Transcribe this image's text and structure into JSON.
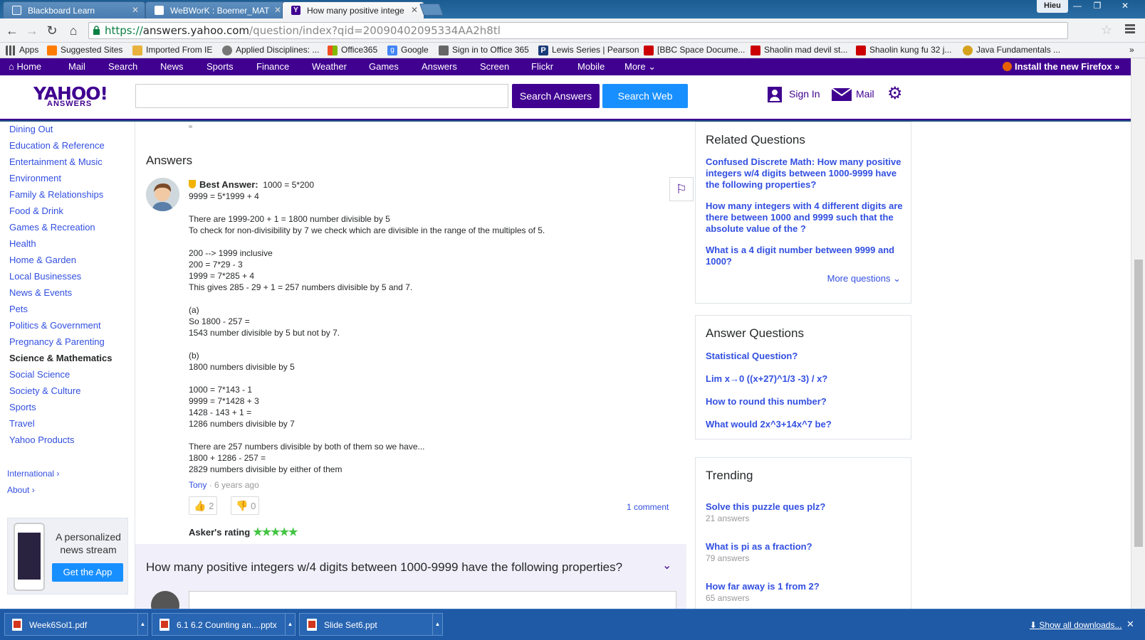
{
  "browser": {
    "tabs": [
      {
        "title": "Blackboard Learn",
        "icon_color": "#4a7db0"
      },
      {
        "title": "WeBWorK : Boerner_MAT",
        "icon_color": "#ffffff"
      },
      {
        "title": "How many positive intege",
        "icon_color": "#400090"
      }
    ],
    "user": "Hieu",
    "url": {
      "scheme": "https://",
      "host": "answers.yahoo.com",
      "path": "/question/index?qid=20090402095334AA2h8tl"
    },
    "bookmarks": [
      {
        "label": "Apps",
        "color": "#555555"
      },
      {
        "label": "Suggested Sites",
        "color": "#ff7c00"
      },
      {
        "label": "Imported From IE",
        "color": "#e8b23c"
      },
      {
        "label": "Applied Disciplines: ...",
        "color": "#777777"
      },
      {
        "label": "Office365",
        "color": "#e34b1c"
      },
      {
        "label": "Google",
        "color": "#4285f4"
      },
      {
        "label": "Sign in to Office 365",
        "color": "#666666"
      },
      {
        "label": "Lewis Series | Pearson",
        "color": "#1a3c78"
      },
      {
        "label": "[BBC Space Docume...",
        "color": "#cc0000"
      },
      {
        "label": "Shaolin mad devil st...",
        "color": "#cc0000"
      },
      {
        "label": "Shaolin kung fu 32 j...",
        "color": "#cc0000"
      },
      {
        "label": "Java Fundamentals ...",
        "color": "#d6a21e"
      }
    ]
  },
  "yahoo_nav": {
    "items": [
      "Home",
      "Mail",
      "Search",
      "News",
      "Sports",
      "Finance",
      "Weather",
      "Games",
      "Answers",
      "Screen",
      "Flickr",
      "Mobile",
      "More"
    ],
    "firefox": "Install the new Firefox »"
  },
  "header": {
    "logo": "YAHOO!",
    "logo_sub": "ANSWERS",
    "search_answers": "Search Answers",
    "search_web": "Search Web",
    "sign_in": "Sign In",
    "mail": "Mail"
  },
  "sidebar": {
    "categories": [
      "Dining Out",
      "Education & Reference",
      "Entertainment & Music",
      "Environment",
      "Family & Relationships",
      "Food & Drink",
      "Games & Recreation",
      "Health",
      "Home & Garden",
      "Local Businesses",
      "News & Events",
      "Pets",
      "Politics & Government",
      "Pregnancy & Parenting",
      "Science & Mathematics",
      "Social Science",
      "Society & Culture",
      "Sports",
      "Travel",
      "Yahoo Products"
    ],
    "active": "Science & Mathematics",
    "international": "International ›",
    "about": "About ›",
    "promo_text": "A personalized news stream",
    "promo_button": "Get the App"
  },
  "answer": {
    "heading": "Answers",
    "best_label": "Best Answer:",
    "first_line": "1000 = 5*200",
    "lines": [
      "9999 = 5*1999 + 4",
      "",
      "There are 1999-200 + 1 = 1800 number divisible by 5",
      "To check for non-divisibility by 7 we check which are divisible in the range of the multiples of 5.",
      "",
      "200 --> 1999 inclusive",
      "200 = 7*29 - 3",
      "1999 = 7*285 + 4",
      "This gives 285 - 29 + 1 = 257 numbers divisible by 5 and 7.",
      "",
      "(a)",
      "So 1800 - 257 =",
      "1543 number divisible by 5 but not by 7.",
      "",
      "(b)",
      "1800 numbers divisible by 5",
      "",
      "1000 = 7*143 - 1",
      "9999 = 7*1428 + 3",
      "1428 - 143 + 1 =",
      "1286 numbers divisible by 7",
      "",
      "There are 257 numbers divisible by both of them so we have...",
      "1800 + 1286 - 257 =",
      "2829 numbers divisible by either of them"
    ],
    "author": "Tony",
    "age": "· 6 years ago",
    "upvotes": "2",
    "downvotes": "0",
    "comments": "1 comment",
    "asker_rating_label": "Asker's rating",
    "stars": "★★★★★"
  },
  "bottom_question": {
    "title": "How many positive integers w/4 digits between 1000-9999 have the following properties?"
  },
  "related": {
    "title": "Related Questions",
    "items": [
      "Confused Discrete Math: How many positive integers w/4 digits between 1000-9999 have the following properties?",
      "How many integers with 4 different digits are there between 1000 and 9999 such that the absolute value of the ?",
      "What is a 4 digit number between 9999 and 1000?"
    ],
    "more": "More questions ⌄"
  },
  "answer_questions": {
    "title": "Answer Questions",
    "items": [
      "Statistical Question?",
      "Lim x→0 ((x+27)^1/3 -3) / x?",
      "How to round this number?",
      "What would 2x^3+14x^7 be?"
    ]
  },
  "trending": {
    "title": "Trending",
    "items": [
      {
        "q": "Solve this puzzle ques plz?",
        "count": "21 answers"
      },
      {
        "q": "What is pi as a fraction?",
        "count": "79 answers"
      },
      {
        "q": "How far away is 1 from 2?",
        "count": "65 answers"
      }
    ]
  },
  "downloads": {
    "items": [
      "Week6Sol1.pdf",
      "6.1 6.2 Counting an....pptx",
      "Slide Set6.ppt"
    ],
    "show_all": "Show all downloads..."
  }
}
